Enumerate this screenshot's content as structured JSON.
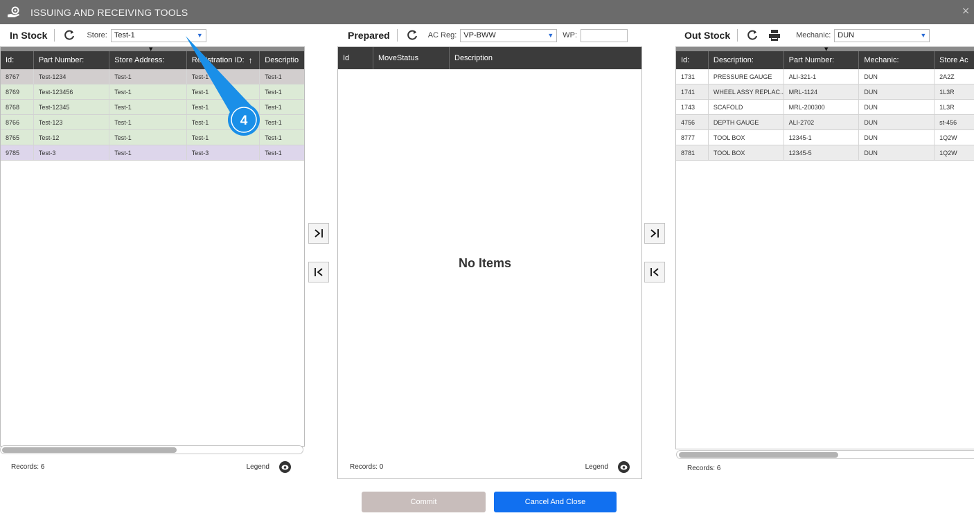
{
  "window": {
    "title": "ISSUING AND RECEIVING TOOLS",
    "close_glyph": "×"
  },
  "in_stock": {
    "title": "In Stock",
    "store_label": "Store:",
    "store_value": "Test-1",
    "columns": [
      "Id:",
      "Part Number:",
      "Store Address:",
      "Registration ID:",
      "Descriptio"
    ],
    "sort_glyph": "↑",
    "rows": [
      {
        "id": "8767",
        "part": "Test-1234",
        "store": "Test-1",
        "reg": "Test-1",
        "desc": "Test-1",
        "bg": "#d2cece"
      },
      {
        "id": "8769",
        "part": "Test-123456",
        "store": "Test-1",
        "reg": "Test-1",
        "desc": "Test-1",
        "bg": "#dcead6"
      },
      {
        "id": "8768",
        "part": "Test-12345",
        "store": "Test-1",
        "reg": "Test-1",
        "desc": "Test-1",
        "bg": "#dcead6"
      },
      {
        "id": "8766",
        "part": "Test-123",
        "store": "Test-1",
        "reg": "Test-1",
        "desc": "Test-1",
        "bg": "#dcead6"
      },
      {
        "id": "8765",
        "part": "Test-12",
        "store": "Test-1",
        "reg": "Test-1",
        "desc": "Test-1",
        "bg": "#dcead6"
      },
      {
        "id": "9785",
        "part": "Test-3",
        "store": "Test-1",
        "reg": "Test-3",
        "desc": "Test-1",
        "bg": "#ddd6eb"
      }
    ],
    "records": "Records: 6",
    "legend": "Legend"
  },
  "prepared": {
    "title": "Prepared",
    "ac_reg_label": "AC Reg:",
    "ac_reg_value": "VP-BWW",
    "wp_label": "WP:",
    "wp_value": "",
    "columns": [
      "Id",
      "MoveStatus",
      "Description"
    ],
    "empty_text": "No Items",
    "records": "Records: 0",
    "legend": "Legend"
  },
  "out_stock": {
    "title": "Out Stock",
    "mechanic_label": "Mechanic:",
    "mechanic_value": "DUN",
    "columns": [
      "Id:",
      "Description:",
      "Part Number:",
      "Mechanic:",
      "Store Ac"
    ],
    "rows": [
      {
        "id": "1731",
        "desc": "PRESSURE GAUGE",
        "part": "ALI-321-1",
        "mech": "DUN",
        "store": "2A2Z",
        "bg": "#ffffff"
      },
      {
        "id": "1741",
        "desc": "WHEEL ASSY REPLAC...",
        "part": "MRL-1124",
        "mech": "DUN",
        "store": "1L3R",
        "bg": "#ececec"
      },
      {
        "id": "1743",
        "desc": "SCAFOLD",
        "part": "MRL-200300",
        "mech": "DUN",
        "store": "1L3R",
        "bg": "#ffffff"
      },
      {
        "id": "4756",
        "desc": "DEPTH GAUGE",
        "part": "ALI-2702",
        "mech": "DUN",
        "store": "st-456",
        "bg": "#ececec"
      },
      {
        "id": "8777",
        "desc": "TOOL BOX",
        "part": "12345-1",
        "mech": "DUN",
        "store": "1Q2W",
        "bg": "#ffffff"
      },
      {
        "id": "8781",
        "desc": "TOOL BOX",
        "part": "12345-5",
        "mech": "DUN",
        "store": "1Q2W",
        "bg": "#ececec"
      }
    ],
    "records": "Records: 6"
  },
  "buttons": {
    "commit": "Commit",
    "cancel_close": "Cancel And Close"
  },
  "callout": {
    "number": "4",
    "color": "#1a8fe8"
  },
  "icons": {
    "app": "tool-hand-icon",
    "refresh": "refresh-icon",
    "print": "printer-icon",
    "eye": "eye-icon",
    "move_right": "move-to-end-icon",
    "move_left": "move-to-start-icon"
  }
}
